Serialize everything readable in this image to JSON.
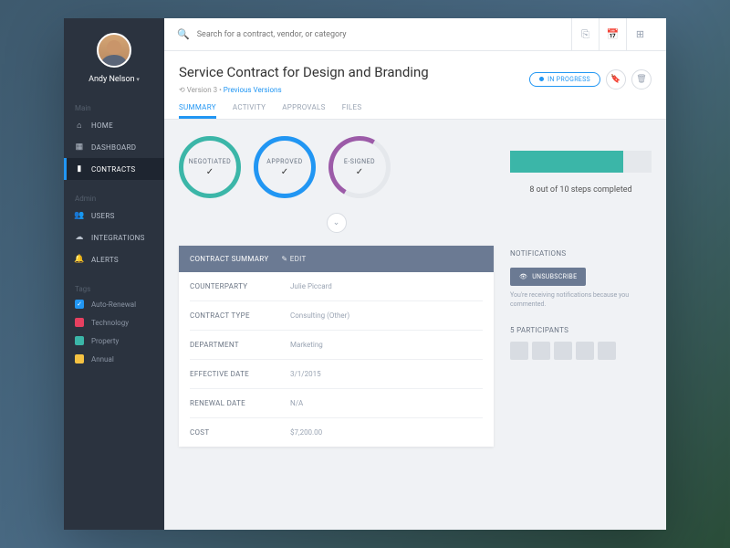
{
  "user": {
    "name": "Andy Nelson"
  },
  "search": {
    "placeholder": "Search for a contract, vendor, or category"
  },
  "nav": {
    "main_label": "Main",
    "admin_label": "Admin",
    "tags_label": "Tags",
    "home": "HOME",
    "dashboard": "DASHBOARD",
    "contracts": "CONTRACTS",
    "users": "USERS",
    "integrations": "INTEGRATIONS",
    "alerts": "ALERTS"
  },
  "tags": {
    "auto_renewal": "Auto-Renewal",
    "technology": "Technology",
    "property": "Property",
    "annual": "Annual",
    "colors": {
      "technology": "#e64060",
      "property": "#3bb6a8",
      "annual": "#f5c242"
    }
  },
  "page": {
    "title": "Service Contract for Design and Branding",
    "version_prefix": "⟲ Version 3  •  ",
    "version_link": "Previous Versions",
    "status": "IN PROGRESS"
  },
  "tabs": {
    "summary": "SUMMARY",
    "activity": "ACTIVITY",
    "approvals": "APPROVALS",
    "files": "FILES"
  },
  "steps": {
    "negotiated": "NEGOTIATED",
    "approved": "APPROVED",
    "esigned": "E-SIGNED"
  },
  "progress": {
    "text": "8 out of 10 steps completed",
    "percent": 80
  },
  "card": {
    "title": "CONTRACT SUMMARY",
    "edit": "EDIT"
  },
  "summary": [
    {
      "label": "COUNTERPARTY",
      "value": "Julie Piccard"
    },
    {
      "label": "CONTRACT TYPE",
      "value": "Consulting (Other)"
    },
    {
      "label": "DEPARTMENT",
      "value": "Marketing"
    },
    {
      "label": "EFFECTIVE DATE",
      "value": "3/1/2015"
    },
    {
      "label": "RENEWAL DATE",
      "value": "N/A"
    },
    {
      "label": "COST",
      "value": "$7,200.00"
    }
  ],
  "notifications": {
    "title": "NOTIFICATIONS",
    "unsubscribe": "UNSUBSCRIBE",
    "note": "You're receiving notifications because you commented."
  },
  "participants": {
    "title": "5 PARTICIPANTS"
  }
}
